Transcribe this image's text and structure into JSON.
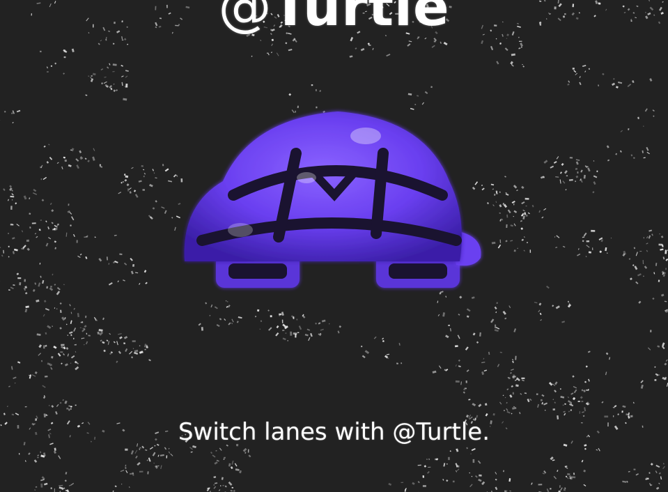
{
  "title": {
    "at_symbol": "@",
    "name": "Turtle"
  },
  "tagline": "Switch lanes with @Turtle.",
  "colors": {
    "background": "#222222",
    "text": "#ffffff",
    "turtle_primary": "#6a3ff0",
    "turtle_dark": "#1a1330",
    "speckle": "#ffffff"
  },
  "icons": {
    "hero": "turtle-icon"
  }
}
